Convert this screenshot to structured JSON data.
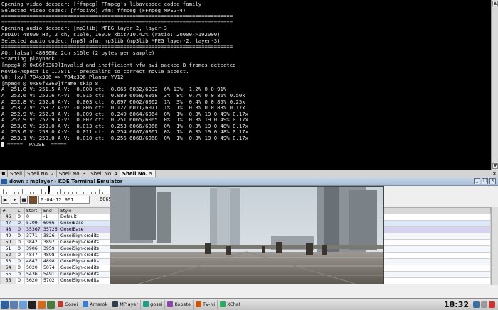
{
  "terminal": {
    "lines": [
      "Opening video decoder: [ffmpeg] FFmpeg's libavcodec codec family",
      "Selected video codec: [ffodivx] vfm: ffmpeg (FFmpeg MPEG-4)",
      "==========================================================================",
      "==========================================================================",
      "Opening audio decoder: [mp3lib] MPEG layer-2, layer-3",
      "AUDIO: 48000 Hz, 2 ch, s16le, 160.0 kbit/10.42% (ratio: 20000->192000)",
      "Selected audio codec: [mp3] afm: mp3lib (mp3lib MPEG layer-2, layer-3)",
      "==========================================================================",
      "AO: [alsa] 48000Hz 2ch s16le (2 bytes per sample)",
      "Starting playback...",
      "[mpeg4 @ 0x86f0360]Invalid and inefficient vfw-avi packed B frames detected",
      "Movie-Aspect is 1.78:1 - prescaling to correct movie aspect.",
      "VO: [xv] 704x396 => 704x396 Planar YV12",
      "[mpeg4 @ 0x86f0360]frame skip 8",
      "A: 251.6 V: 251.5 A-V:  0.008 ct:  0.065 6032/6032  6% 13%  1.2% 0 0 91%",
      "A: 252.6 V: 252.6 A-V:  0.015 ct:  0.089 6058/6058  3%  8%  0.7% 0 0 86% 0.50x",
      "A: 252.8 V: 252.8 A-V:  0.003 ct:  0.097 6062/6062  1%  3%  0.4% 0 0 85% 0.25x",
      "A: 253.2 V: 253.2 A-V: -0.006 ct:  0.127 6071/6071  1%  1%  0.3% 0 0 83% 0.17x",
      "A: 252.9 V: 252.9 A-V: -0.009 ct:  0.249 6064/6064  0%  1%  0.3% 19 0 49% 0.17x",
      "A: 252.9 V: 252.9 A-V:  0.002 ct:  0.251 6065/6065  0%  1%  0.3% 19 0 49% 0.17x",
      "A: 253.0 V: 253.0 A-V:  0.013 ct:  0.253 6066/6066  0%  1%  0.3% 19 0 48% 0.17x",
      "A: 253.0 V: 253.0 A-V:  0.011 ct:  0.254 6067/6067  0%  1%  0.3% 19 0 48% 0.17x",
      "A: 253.1 V: 253.0 A-V:  0.010 ct:  0.256 6068/6068  0%  1%  0.3% 19 0 49% 0.17x"
    ],
    "pause_line": "=====  PAUSE  ====="
  },
  "tabs": [
    "Shell",
    "Shell No. 2",
    "Shell No. 3",
    "Shell No. 4",
    "Shell No. 5"
  ],
  "active_tab": 4,
  "window": {
    "title": "down : mplayer - KDE Terminal Emulator"
  },
  "editor": {
    "time_start": "0:04:12.961",
    "time_sep": "-",
    "time_end": "6065",
    "columns": [
      "#",
      "L",
      "Start",
      "End",
      "Style"
    ],
    "rows": [
      {
        "n": "46",
        "l": "0",
        "start": "0",
        "end": "-1",
        "style": "Default"
      },
      {
        "n": "47",
        "l": "0",
        "start": "5709",
        "end": "6066",
        "style": "GoseiBase"
      },
      {
        "n": "48",
        "l": "0",
        "start": "35367",
        "end": "35726",
        "style": "GoseiBase"
      },
      {
        "n": "49",
        "l": "0",
        "start": "3771",
        "end": "3826",
        "style": "GoseiSign-credits"
      },
      {
        "n": "50",
        "l": "0",
        "start": "3842",
        "end": "3897",
        "style": "GoseiSign-credits"
      },
      {
        "n": "51",
        "l": "0",
        "start": "3906",
        "end": "3959",
        "style": "GoseiSign-credits"
      },
      {
        "n": "52",
        "l": "0",
        "start": "4847",
        "end": "4898",
        "style": "GoseiSign-credits"
      },
      {
        "n": "53",
        "l": "0",
        "start": "4847",
        "end": "4898",
        "style": "GoseiSign-credits"
      },
      {
        "n": "54",
        "l": "0",
        "start": "5020",
        "end": "5074",
        "style": "GoseiSign-credits"
      },
      {
        "n": "55",
        "l": "0",
        "start": "5436",
        "end": "5491",
        "style": "GoseiSign-credits"
      },
      {
        "n": "56",
        "l": "0",
        "start": "5620",
        "end": "5702",
        "style": "GoseiSign-credits"
      }
    ]
  },
  "taskbar": {
    "tasks": [
      "Gosei",
      "Amarok",
      "MPlayer",
      "gosei",
      "Kopete",
      "TV-Ni",
      "XChat"
    ],
    "clock": "18:32"
  },
  "colors": {
    "terminal_bg": "#000000",
    "terminal_fg": "#e6e6e6",
    "row_selected_1": "#dce8f7",
    "row_selected_2": "#d7d2f0"
  }
}
